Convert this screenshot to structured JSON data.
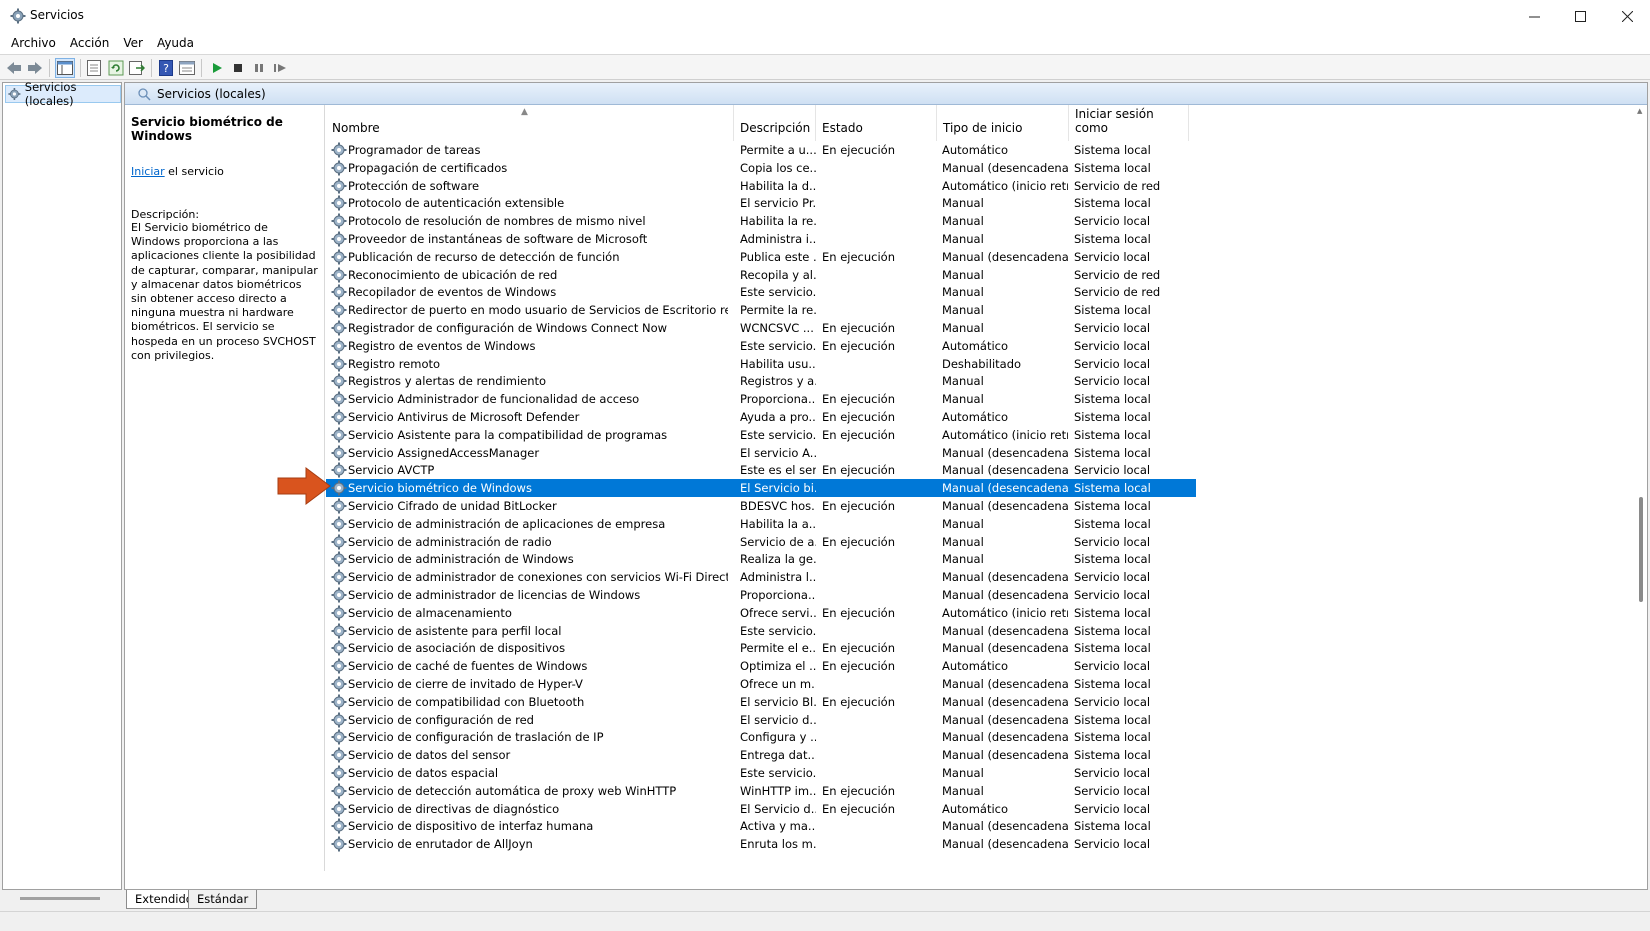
{
  "window": {
    "title": "Servicios"
  },
  "menu": [
    "Archivo",
    "Acción",
    "Ver",
    "Ayuda"
  ],
  "tree": {
    "root_label": "Servicios (locales)"
  },
  "main_header": {
    "title": "Servicios (locales)"
  },
  "detail": {
    "title": "Servicio biométrico de Windows",
    "start_link": "Iniciar",
    "start_suffix": " el servicio",
    "description_label": "Descripción:",
    "description": "El Servicio biométrico de Windows proporciona a las aplicaciones cliente la posibilidad de capturar, comparar, manipular y almacenar datos biométricos sin obtener acceso directo a ninguna muestra ni hardware biométricos. El servicio se hospeda en un proceso SVCHOST con privilegios."
  },
  "columns": [
    "Nombre",
    "Descripción",
    "Estado",
    "Tipo de inicio",
    "Iniciar sesión como"
  ],
  "rows": [
    {
      "name": "Programador de tareas",
      "desc": "Permite a u...",
      "state": "En ejecución",
      "start": "Automático",
      "logon": "Sistema local"
    },
    {
      "name": "Propagación de certificados",
      "desc": "Copia los ce...",
      "state": "",
      "start": "Manual (desencadenar...",
      "logon": "Sistema local"
    },
    {
      "name": "Protección de software",
      "desc": "Habilita la d...",
      "state": "",
      "start": "Automático (inicio retr...",
      "logon": "Servicio de red"
    },
    {
      "name": "Protocolo de autenticación extensible",
      "desc": "El servicio Pr...",
      "state": "",
      "start": "Manual",
      "logon": "Sistema local"
    },
    {
      "name": "Protocolo de resolución de nombres de mismo nivel",
      "desc": "Habilita la re...",
      "state": "",
      "start": "Manual",
      "logon": "Servicio local"
    },
    {
      "name": "Proveedor de instantáneas de software de Microsoft",
      "desc": "Administra i...",
      "state": "",
      "start": "Manual",
      "logon": "Sistema local"
    },
    {
      "name": "Publicación de recurso de detección de función",
      "desc": "Publica este ...",
      "state": "En ejecución",
      "start": "Manual (desencadenar...",
      "logon": "Servicio local"
    },
    {
      "name": "Reconocimiento de ubicación de red",
      "desc": "Recopila y al...",
      "state": "",
      "start": "Manual",
      "logon": "Servicio de red"
    },
    {
      "name": "Recopilador de eventos de Windows",
      "desc": "Este servicio...",
      "state": "",
      "start": "Manual",
      "logon": "Servicio de red"
    },
    {
      "name": "Redirector de puerto en modo usuario de Servicios de Escritorio remoto",
      "desc": "Permite la re...",
      "state": "",
      "start": "Manual",
      "logon": "Sistema local"
    },
    {
      "name": "Registrador de configuración de Windows Connect Now",
      "desc": "WCNCSVC ...",
      "state": "En ejecución",
      "start": "Manual",
      "logon": "Servicio local"
    },
    {
      "name": "Registro de eventos de Windows",
      "desc": "Este servicio...",
      "state": "En ejecución",
      "start": "Automático",
      "logon": "Servicio local"
    },
    {
      "name": "Registro remoto",
      "desc": "Habilita usu...",
      "state": "",
      "start": "Deshabilitado",
      "logon": "Servicio local"
    },
    {
      "name": "Registros y alertas de rendimiento",
      "desc": "Registros y a...",
      "state": "",
      "start": "Manual",
      "logon": "Servicio local"
    },
    {
      "name": "Servicio Administrador de funcionalidad de acceso",
      "desc": "Proporciona...",
      "state": "En ejecución",
      "start": "Manual",
      "logon": "Sistema local"
    },
    {
      "name": "Servicio Antivirus de Microsoft Defender",
      "desc": "Ayuda a pro...",
      "state": "En ejecución",
      "start": "Automático",
      "logon": "Sistema local"
    },
    {
      "name": "Servicio Asistente para la compatibilidad de programas",
      "desc": "Este servicio...",
      "state": "En ejecución",
      "start": "Automático (inicio retr...",
      "logon": "Sistema local"
    },
    {
      "name": "Servicio AssignedAccessManager",
      "desc": "El servicio A...",
      "state": "",
      "start": "Manual (desencadenar...",
      "logon": "Sistema local"
    },
    {
      "name": "Servicio AVCTP",
      "desc": "Este es el ser...",
      "state": "En ejecución",
      "start": "Manual (desencadenar...",
      "logon": "Servicio local"
    },
    {
      "name": "Servicio biométrico de Windows",
      "desc": "El Servicio bi...",
      "state": "",
      "start": "Manual (desencadenar...",
      "logon": "Sistema local",
      "selected": true
    },
    {
      "name": "Servicio Cifrado de unidad BitLocker",
      "desc": "BDESVC hos...",
      "state": "En ejecución",
      "start": "Manual (desencadenar...",
      "logon": "Sistema local"
    },
    {
      "name": "Servicio de administración de aplicaciones de empresa",
      "desc": "Habilita la a...",
      "state": "",
      "start": "Manual",
      "logon": "Sistema local"
    },
    {
      "name": "Servicio de administración de radio",
      "desc": "Servicio de a...",
      "state": "En ejecución",
      "start": "Manual",
      "logon": "Servicio local"
    },
    {
      "name": "Servicio de administración de Windows",
      "desc": "Realiza la ge...",
      "state": "",
      "start": "Manual",
      "logon": "Sistema local"
    },
    {
      "name": "Servicio de administrador de conexiones con servicios Wi-Fi Direct",
      "desc": "Administra l...",
      "state": "",
      "start": "Manual (desencadenar...",
      "logon": "Servicio local"
    },
    {
      "name": "Servicio de administrador de licencias de Windows",
      "desc": "Proporciona...",
      "state": "",
      "start": "Manual (desencadenar...",
      "logon": "Servicio local"
    },
    {
      "name": "Servicio de almacenamiento",
      "desc": "Ofrece servi...",
      "state": "En ejecución",
      "start": "Automático (inicio retr...",
      "logon": "Sistema local"
    },
    {
      "name": "Servicio de asistente para perfil local",
      "desc": "Este servicio...",
      "state": "",
      "start": "Manual (desencadenar...",
      "logon": "Sistema local"
    },
    {
      "name": "Servicio de asociación de dispositivos",
      "desc": "Permite el e...",
      "state": "En ejecución",
      "start": "Manual (desencadenar...",
      "logon": "Sistema local"
    },
    {
      "name": "Servicio de caché de fuentes de Windows",
      "desc": "Optimiza el ...",
      "state": "En ejecución",
      "start": "Automático",
      "logon": "Servicio local"
    },
    {
      "name": "Servicio de cierre de invitado de Hyper-V",
      "desc": "Ofrece un m...",
      "state": "",
      "start": "Manual (desencadenar...",
      "logon": "Sistema local"
    },
    {
      "name": "Servicio de compatibilidad con Bluetooth",
      "desc": "El servicio Bl...",
      "state": "En ejecución",
      "start": "Manual (desencadenar...",
      "logon": "Servicio local"
    },
    {
      "name": "Servicio de configuración de red",
      "desc": "El servicio d...",
      "state": "",
      "start": "Manual (desencadenar...",
      "logon": "Sistema local"
    },
    {
      "name": "Servicio de configuración de traslación de IP",
      "desc": "Configura y ...",
      "state": "",
      "start": "Manual (desencadenar...",
      "logon": "Sistema local"
    },
    {
      "name": "Servicio de datos del sensor",
      "desc": "Entrega dat...",
      "state": "",
      "start": "Manual (desencadenar...",
      "logon": "Sistema local"
    },
    {
      "name": "Servicio de datos espacial",
      "desc": "Este servicio...",
      "state": "",
      "start": "Manual",
      "logon": "Servicio local"
    },
    {
      "name": "Servicio de detección automática de proxy web WinHTTP",
      "desc": "WinHTTP im...",
      "state": "En ejecución",
      "start": "Manual",
      "logon": "Servicio local"
    },
    {
      "name": "Servicio de directivas de diagnóstico",
      "desc": "El Servicio d...",
      "state": "En ejecución",
      "start": "Automático",
      "logon": "Servicio local"
    },
    {
      "name": "Servicio de dispositivo de interfaz humana",
      "desc": "Activa y ma...",
      "state": "",
      "start": "Manual (desencadenar...",
      "logon": "Sistema local"
    },
    {
      "name": "Servicio de enrutador de AllJoyn",
      "desc": "Enruta los m...",
      "state": "",
      "start": "Manual (desencadenar...",
      "logon": "Servicio local"
    }
  ],
  "tabs": [
    "Extendido",
    "Estándar"
  ],
  "colors": {
    "selection": "#0078d7",
    "link": "#0066cc",
    "arrow": "#d9541e",
    "header_band": "#cfe0f3"
  },
  "icons": [
    "gear-icon",
    "back-icon",
    "forward-icon",
    "play-icon",
    "stop-icon",
    "pause-icon",
    "restart-icon",
    "help-icon"
  ]
}
